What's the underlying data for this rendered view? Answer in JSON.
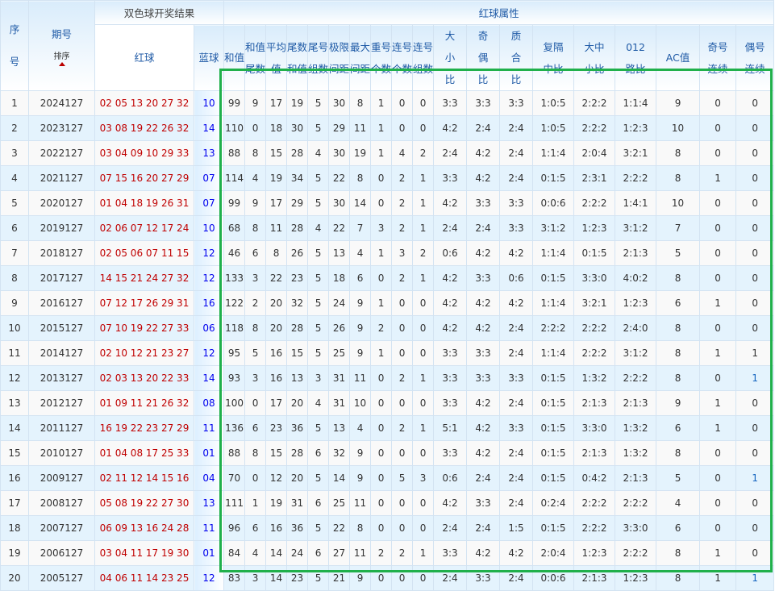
{
  "header": {
    "seq": "序号",
    "issue": "期号",
    "sort": "排序",
    "draw_group": "双色球开奖结果",
    "attr_group": "红球属性",
    "red": "红球",
    "blue": "蓝球",
    "columns": [
      "和值",
      "和值尾数",
      "平均值",
      "尾数和值",
      "尾号组数",
      "极限间距",
      "最大间距",
      "重号个数",
      "连号个数",
      "连号组数",
      "大小比",
      "奇偶比",
      "质合比",
      "复隔中比",
      "大中小比",
      "012路比",
      "AC值",
      "奇号连续",
      "偶号连续"
    ]
  },
  "colors": {
    "red_ball": "#c00000",
    "blue_ball": "#0000ee",
    "highlight_box": "#20b04b"
  },
  "rows": [
    {
      "seq": "1",
      "issue": "2024127",
      "red": "02 05 13 20 27 32",
      "blue": "10",
      "attrs": [
        "99",
        "9",
        "17",
        "19",
        "5",
        "30",
        "8",
        "1",
        "0",
        "0",
        "3:3",
        "3:3",
        "3:3",
        "1:0:5",
        "2:2:2",
        "1:1:4",
        "9",
        "0",
        "0"
      ]
    },
    {
      "seq": "2",
      "issue": "2023127",
      "red": "03 08 19 22 26 32",
      "blue": "14",
      "attrs": [
        "110",
        "0",
        "18",
        "30",
        "5",
        "29",
        "11",
        "1",
        "0",
        "0",
        "4:2",
        "2:4",
        "2:4",
        "1:0:5",
        "2:2:2",
        "1:2:3",
        "10",
        "0",
        "0"
      ]
    },
    {
      "seq": "3",
      "issue": "2022127",
      "red": "03 04 09 10 29 33",
      "blue": "13",
      "attrs": [
        "88",
        "8",
        "15",
        "28",
        "4",
        "30",
        "19",
        "1",
        "4",
        "2",
        "2:4",
        "4:2",
        "2:4",
        "1:1:4",
        "2:0:4",
        "3:2:1",
        "8",
        "0",
        "0"
      ]
    },
    {
      "seq": "4",
      "issue": "2021127",
      "red": "07 15 16 20 27 29",
      "blue": "07",
      "attrs": [
        "114",
        "4",
        "19",
        "34",
        "5",
        "22",
        "8",
        "0",
        "2",
        "1",
        "3:3",
        "4:2",
        "2:4",
        "0:1:5",
        "2:3:1",
        "2:2:2",
        "8",
        "1",
        "0"
      ]
    },
    {
      "seq": "5",
      "issue": "2020127",
      "red": "01 04 18 19 26 31",
      "blue": "07",
      "attrs": [
        "99",
        "9",
        "17",
        "29",
        "5",
        "30",
        "14",
        "0",
        "2",
        "1",
        "4:2",
        "3:3",
        "3:3",
        "0:0:6",
        "2:2:2",
        "1:4:1",
        "10",
        "0",
        "0"
      ]
    },
    {
      "seq": "6",
      "issue": "2019127",
      "red": "02 06 07 12 17 24",
      "blue": "10",
      "attrs": [
        "68",
        "8",
        "11",
        "28",
        "4",
        "22",
        "7",
        "3",
        "2",
        "1",
        "2:4",
        "2:4",
        "3:3",
        "3:1:2",
        "1:2:3",
        "3:1:2",
        "7",
        "0",
        "0"
      ]
    },
    {
      "seq": "7",
      "issue": "2018127",
      "red": "02 05 06 07 11 15",
      "blue": "12",
      "attrs": [
        "46",
        "6",
        "8",
        "26",
        "5",
        "13",
        "4",
        "1",
        "3",
        "2",
        "0:6",
        "4:2",
        "4:2",
        "1:1:4",
        "0:1:5",
        "2:1:3",
        "5",
        "0",
        "0"
      ]
    },
    {
      "seq": "8",
      "issue": "2017127",
      "red": "14 15 21 24 27 32",
      "blue": "12",
      "attrs": [
        "133",
        "3",
        "22",
        "23",
        "5",
        "18",
        "6",
        "0",
        "2",
        "1",
        "4:2",
        "3:3",
        "0:6",
        "0:1:5",
        "3:3:0",
        "4:0:2",
        "8",
        "0",
        "0"
      ]
    },
    {
      "seq": "9",
      "issue": "2016127",
      "red": "07 12 17 26 29 31",
      "blue": "16",
      "attrs": [
        "122",
        "2",
        "20",
        "32",
        "5",
        "24",
        "9",
        "1",
        "0",
        "0",
        "4:2",
        "4:2",
        "4:2",
        "1:1:4",
        "3:2:1",
        "1:2:3",
        "6",
        "1",
        "0"
      ]
    },
    {
      "seq": "10",
      "issue": "2015127",
      "red": "07 10 19 22 27 33",
      "blue": "06",
      "attrs": [
        "118",
        "8",
        "20",
        "28",
        "5",
        "26",
        "9",
        "2",
        "0",
        "0",
        "4:2",
        "4:2",
        "2:4",
        "2:2:2",
        "2:2:2",
        "2:4:0",
        "8",
        "0",
        "0"
      ]
    },
    {
      "seq": "11",
      "issue": "2014127",
      "red": "02 10 12 21 23 27",
      "blue": "12",
      "attrs": [
        "95",
        "5",
        "16",
        "15",
        "5",
        "25",
        "9",
        "1",
        "0",
        "0",
        "3:3",
        "3:3",
        "2:4",
        "1:1:4",
        "2:2:2",
        "3:1:2",
        "8",
        "1",
        "1"
      ]
    },
    {
      "seq": "12",
      "issue": "2013127",
      "red": "02 03 13 20 22 33",
      "blue": "14",
      "attrs": [
        "93",
        "3",
        "16",
        "13",
        "3",
        "31",
        "11",
        "0",
        "2",
        "1",
        "3:3",
        "3:3",
        "3:3",
        "0:1:5",
        "1:3:2",
        "2:2:2",
        "8",
        "0",
        "1"
      ],
      "hl_last": true
    },
    {
      "seq": "13",
      "issue": "2012127",
      "red": "01 09 11 21 26 32",
      "blue": "08",
      "attrs": [
        "100",
        "0",
        "17",
        "20",
        "4",
        "31",
        "10",
        "0",
        "0",
        "0",
        "3:3",
        "4:2",
        "2:4",
        "0:1:5",
        "2:1:3",
        "2:1:3",
        "9",
        "1",
        "0"
      ]
    },
    {
      "seq": "14",
      "issue": "2011127",
      "red": "16 19 22 23 27 29",
      "blue": "11",
      "attrs": [
        "136",
        "6",
        "23",
        "36",
        "5",
        "13",
        "4",
        "0",
        "2",
        "1",
        "5:1",
        "4:2",
        "3:3",
        "0:1:5",
        "3:3:0",
        "1:3:2",
        "6",
        "1",
        "0"
      ]
    },
    {
      "seq": "15",
      "issue": "2010127",
      "red": "01 04 08 17 25 33",
      "blue": "01",
      "attrs": [
        "88",
        "8",
        "15",
        "28",
        "6",
        "32",
        "9",
        "0",
        "0",
        "0",
        "3:3",
        "4:2",
        "2:4",
        "0:1:5",
        "2:1:3",
        "1:3:2",
        "8",
        "0",
        "0"
      ]
    },
    {
      "seq": "16",
      "issue": "2009127",
      "red": "02 11 12 14 15 16",
      "blue": "04",
      "attrs": [
        "70",
        "0",
        "12",
        "20",
        "5",
        "14",
        "9",
        "0",
        "5",
        "3",
        "0:6",
        "2:4",
        "2:4",
        "0:1:5",
        "0:4:2",
        "2:1:3",
        "5",
        "0",
        "1"
      ],
      "hl_last": true
    },
    {
      "seq": "17",
      "issue": "2008127",
      "red": "05 08 19 22 27 30",
      "blue": "13",
      "attrs": [
        "111",
        "1",
        "19",
        "31",
        "6",
        "25",
        "11",
        "0",
        "0",
        "0",
        "4:2",
        "3:3",
        "2:4",
        "0:2:4",
        "2:2:2",
        "2:2:2",
        "4",
        "0",
        "0"
      ]
    },
    {
      "seq": "18",
      "issue": "2007127",
      "red": "06 09 13 16 24 28",
      "blue": "11",
      "attrs": [
        "96",
        "6",
        "16",
        "36",
        "5",
        "22",
        "8",
        "0",
        "0",
        "0",
        "2:4",
        "2:4",
        "1:5",
        "0:1:5",
        "2:2:2",
        "3:3:0",
        "6",
        "0",
        "0"
      ]
    },
    {
      "seq": "19",
      "issue": "2006127",
      "red": "03 04 11 17 19 30",
      "blue": "01",
      "attrs": [
        "84",
        "4",
        "14",
        "24",
        "6",
        "27",
        "11",
        "2",
        "2",
        "1",
        "3:3",
        "4:2",
        "4:2",
        "2:0:4",
        "1:2:3",
        "2:2:2",
        "8",
        "1",
        "0"
      ]
    },
    {
      "seq": "20",
      "issue": "2005127",
      "red": "04 06 11 14 23 25",
      "blue": "12",
      "attrs": [
        "83",
        "3",
        "14",
        "23",
        "5",
        "21",
        "9",
        "0",
        "0",
        "0",
        "2:4",
        "3:3",
        "2:4",
        "0:0:6",
        "2:1:3",
        "1:2:3",
        "8",
        "1",
        "1"
      ],
      "hl_last": true
    }
  ]
}
